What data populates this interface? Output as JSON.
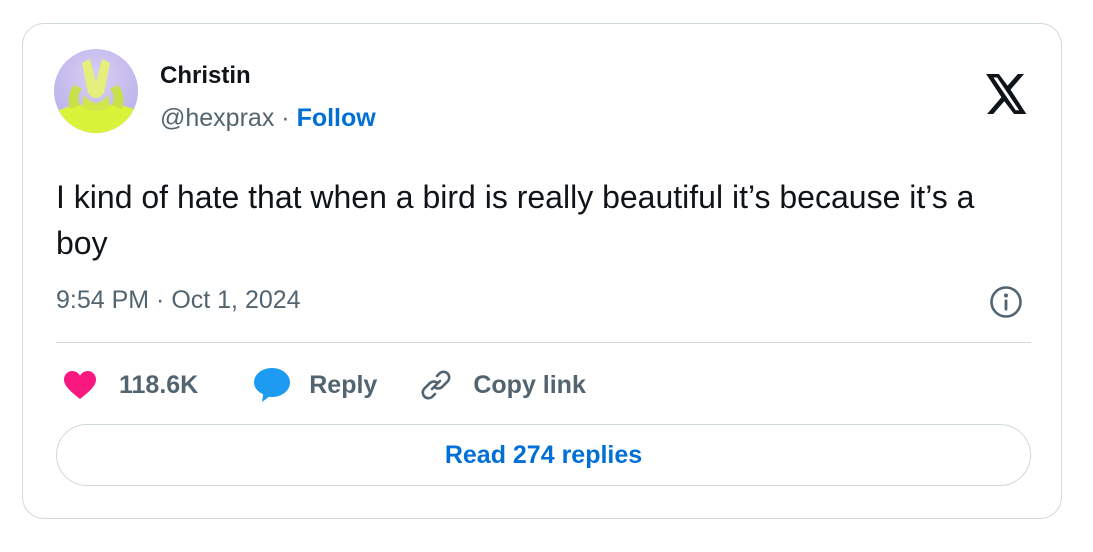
{
  "author": {
    "display_name": "Christin",
    "handle": "@hexprax",
    "separator": "·",
    "follow_label": "Follow"
  },
  "tweet": {
    "text": "I kind of hate that when a bird is really beautiful it’s because it’s a boy",
    "timestamp": "9:54 PM · Oct 1, 2024"
  },
  "actions": {
    "like_count": "118.6K",
    "reply_label": "Reply",
    "copy_link_label": "Copy link"
  },
  "read_replies_label": "Read 274 replies",
  "icons": {
    "brand": "x-logo-icon",
    "info": "info-icon",
    "like": "heart-icon",
    "reply": "speech-bubble-icon",
    "copy": "link-icon"
  },
  "colors": {
    "link_blue": "#006fd6",
    "like_pink": "#f91880",
    "reply_blue": "#1d9bf0",
    "muted_text": "#536471",
    "border": "#cfd9de"
  }
}
